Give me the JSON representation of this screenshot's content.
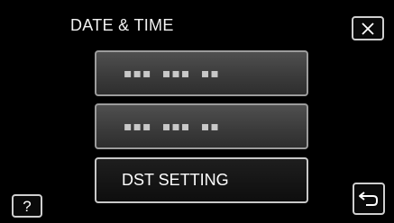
{
  "header": {
    "title": "DATE & TIME"
  },
  "buttons": {
    "close_icon": "close-icon",
    "help_label": "?",
    "back_icon": "return-arrow-icon"
  },
  "menu": {
    "items": [
      {
        "label": "▪▪▪ ▪▪▪ ▪▪",
        "state": "blurred"
      },
      {
        "label": "▪▪▪ ▪▪▪ ▪▪",
        "state": "blurred"
      },
      {
        "label": "DST SETTING",
        "state": "normal"
      }
    ]
  }
}
